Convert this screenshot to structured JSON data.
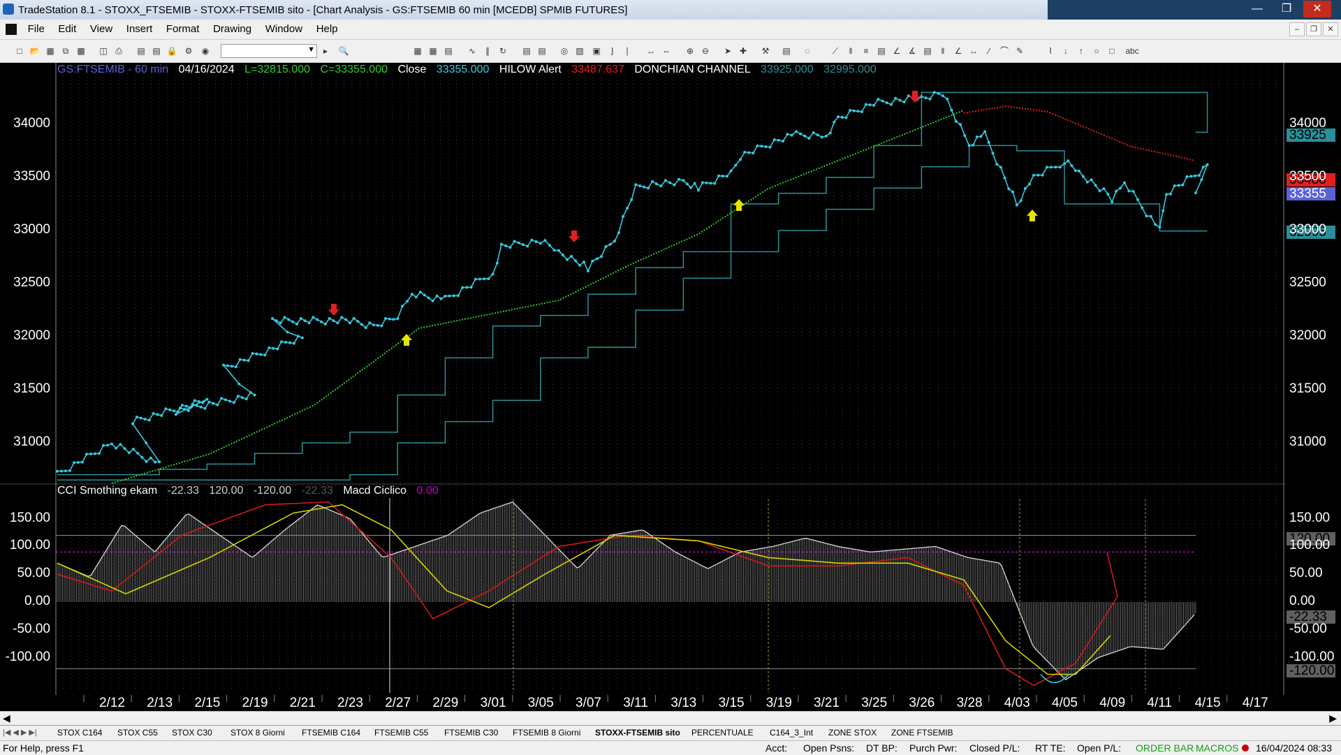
{
  "window": {
    "title": "TradeStation 8.1 - STOXX_FTSEMIB - STOXX-FTSEMIB sito - [Chart Analysis - GS:FTSEMIB  60 min  [MCEDB] SPMIB FUTURES]"
  },
  "menu": [
    "File",
    "Edit",
    "View",
    "Insert",
    "Format",
    "Drawing",
    "Window",
    "Help"
  ],
  "toolbar": {
    "symbol_value": ""
  },
  "price_header": {
    "symbol": "GS:FTSEMIB - 60 min",
    "date": "04/16/2024",
    "low": "L=32815.000",
    "close": "C=33355.000",
    "close_label": "Close",
    "close_value": "33355.000",
    "alert_label": "HILOW Alert",
    "alert_value": "33487.637",
    "donchian_label": "DONCHIAN CHANNEL",
    "donchian_upper": "33925.000",
    "donchian_lower": "32995.000"
  },
  "indicator_header": {
    "name": "CCI Smothing ekam",
    "v1": "-22.33",
    "v2": "120.00",
    "v3": "-120.00",
    "v4": "-22.33",
    "macd_label": "Macd Ciclico",
    "macd_value": "0.00"
  },
  "price_tags": {
    "upper": "33925",
    "alert": "33488",
    "last": "33355",
    "lower": "32995"
  },
  "ind_tags": {
    "upper": "120.00",
    "last": "-22.33",
    "lower": "-120.00"
  },
  "colors": {
    "price": "#37c8dc",
    "donchian": "#2a8f98",
    "ma": "#2ecc2e",
    "alert": "#e02020",
    "cci_red": "#d11a1a",
    "cci_yellow": "#d4d400",
    "bars": "#8a8a8a",
    "macd": "#c000c0"
  },
  "chart_data": [
    {
      "type": "line",
      "title": "GS:FTSEMIB - 60 min",
      "x_tick_labels": [
        "2/12",
        "2/13",
        "2/15",
        "2/19",
        "2/21",
        "2/23",
        "2/27",
        "2/29",
        "3/01",
        "3/05",
        "3/07",
        "3/11",
        "3/13",
        "3/15",
        "3/19",
        "3/21",
        "3/25",
        "3/26",
        "3/28",
        "4/03",
        "4/05",
        "4/09",
        "4/11",
        "4/15",
        "4/17"
      ],
      "y_tick_labels": [
        "34000",
        "33500",
        "33000",
        "32500",
        "32000",
        "31500",
        "31000"
      ],
      "ylim": [
        30650,
        34400
      ],
      "series": [
        {
          "name": "Close",
          "x": [
            "2/09",
            "2/12",
            "2/13",
            "2/14",
            "2/15",
            "2/16",
            "2/19",
            "2/20",
            "2/21",
            "2/22",
            "2/23",
            "2/26",
            "2/27",
            "2/28",
            "2/29",
            "3/01",
            "3/04",
            "3/05",
            "3/06",
            "3/07",
            "3/08",
            "3/11",
            "3/12",
            "3/13",
            "3/14",
            "3/15",
            "3/18",
            "3/19",
            "3/20",
            "3/21",
            "3/22",
            "3/25",
            "3/26",
            "3/27",
            "3/28",
            "4/02",
            "4/03",
            "4/04",
            "4/05",
            "4/08",
            "4/09",
            "4/10",
            "4/11",
            "4/12",
            "4/15",
            "4/16"
          ],
          "values": [
            30700,
            31000,
            30800,
            31200,
            31400,
            31300,
            31450,
            31700,
            32000,
            32150,
            32150,
            32100,
            32200,
            32400,
            32350,
            32600,
            32850,
            32900,
            32800,
            32650,
            32900,
            33400,
            33450,
            33450,
            33400,
            33550,
            33700,
            33850,
            33900,
            33900,
            34050,
            34200,
            34250,
            34300,
            33800,
            33900,
            33250,
            33500,
            33650,
            33550,
            33300,
            33450,
            33000,
            33350,
            33600,
            33355
          ]
        },
        {
          "name": "DONCHIAN CHANNEL",
          "x": [
            "2/09",
            "2/13",
            "2/15",
            "2/19",
            "2/21",
            "2/23",
            "2/27",
            "2/29",
            "3/01",
            "3/05",
            "3/07",
            "3/11",
            "3/13",
            "3/15",
            "3/19",
            "3/21",
            "3/25",
            "3/26",
            "3/28",
            "4/03",
            "4/05",
            "4/09",
            "4/11",
            "4/15",
            "4/16"
          ],
          "values": [
            30700,
            30750,
            30800,
            30900,
            31000,
            31100,
            31450,
            31800,
            32100,
            32200,
            32400,
            32650,
            32800,
            33250,
            33350,
            33500,
            33800,
            34300,
            34300,
            34300,
            34300,
            34300,
            34300,
            33925,
            33925
          ]
        },
        {
          "name": "DONCHIAN CHANNEL (lower)",
          "values": [
            30650,
            30650,
            30650,
            30650,
            30650,
            30700,
            31000,
            31200,
            31400,
            31800,
            31900,
            32250,
            32550,
            32800,
            33000,
            33200,
            33400,
            33600,
            33800,
            33750,
            33250,
            33250,
            32995,
            32995,
            32995
          ]
        }
      ]
    },
    {
      "type": "line",
      "title": "CCI Smothing ekam",
      "y_tick_labels": [
        "150.00",
        "100.00",
        "50.00",
        "0.00",
        "-50.00",
        "-100.00"
      ],
      "ylim": [
        -160,
        190
      ],
      "series": [
        {
          "name": "CCI",
          "values": [
            70,
            45,
            140,
            90,
            160,
            120,
            80,
            130,
            175,
            150,
            80,
            100,
            120,
            160,
            180,
            120,
            60,
            120,
            130,
            90,
            60,
            90,
            100,
            115,
            100,
            90,
            95,
            100,
            80,
            70,
            -80,
            -140,
            -100,
            -80,
            -85,
            -20
          ]
        },
        {
          "name": "Macd Ciclico",
          "values": [
            0,
            0,
            0,
            0,
            0,
            0
          ]
        }
      ]
    }
  ],
  "tabs": [
    "STOX C164",
    "STOX C55",
    "STOX  C30",
    "STOX  8 Giorni",
    "FTSEMIB C164",
    "FTSEMIB C55",
    "FTSEMIB C30",
    "FTSEMIB  8 Giorni",
    "STOXX-FTSEMIB sito",
    "PERCENTUALE",
    "C164_3_Int",
    "ZONE STOX",
    "ZONE FTSEMIB"
  ],
  "status": {
    "help": "For Help, press F1",
    "acct": "Acct:",
    "open_psns": "Open Psns:",
    "dt_bp": "DT BP:",
    "purch_pwr": "Purch Pwr:",
    "closed_pl": "Closed P/L:",
    "rt_te": "RT TE:",
    "open_pl": "Open P/L:",
    "order_bar": "ORDER BAR",
    "macros": "MACROS",
    "datetime": "16/04/2024 08:33"
  }
}
